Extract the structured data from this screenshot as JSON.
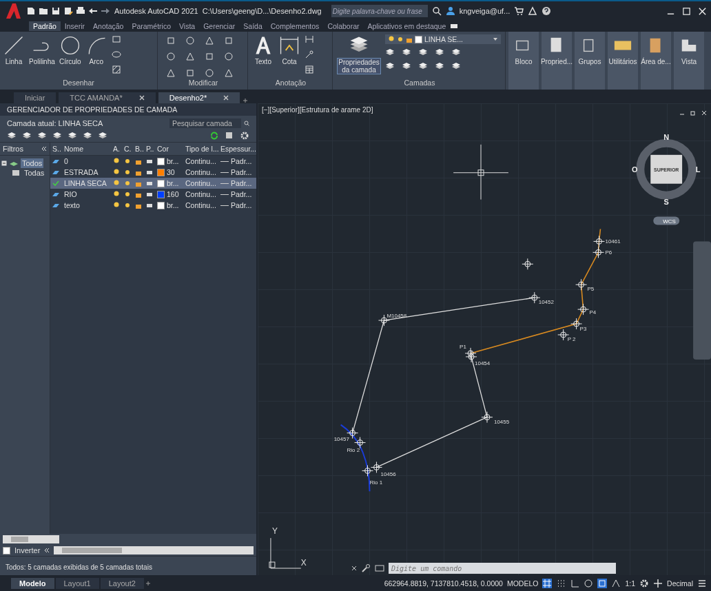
{
  "title_bar": {
    "title": "Autodesk AutoCAD 2021",
    "path": "C:\\Users\\geeng\\D...\\Desenho2.dwg",
    "search_placeholder": "Digite palavra-chave ou frase",
    "user": "kngveiga@uf..."
  },
  "ribbon_tabs": [
    {
      "label": "Padrão",
      "selected": true
    },
    {
      "label": "Inserir",
      "selected": false
    },
    {
      "label": "Anotação",
      "selected": false
    },
    {
      "label": "Paramétrico",
      "selected": false
    },
    {
      "label": "Vista",
      "selected": false
    },
    {
      "label": "Gerenciar",
      "selected": false
    },
    {
      "label": "Saída",
      "selected": false
    },
    {
      "label": "Complementos",
      "selected": false
    },
    {
      "label": "Colaborar",
      "selected": false
    },
    {
      "label": "Aplicativos em destaque",
      "selected": false
    }
  ],
  "draw_panel": {
    "title": "Desenhar",
    "tools": [
      "Linha",
      "Polilinha",
      "Círculo",
      "Arco"
    ]
  },
  "modify_panel": {
    "title": "Modificar"
  },
  "annotation_panel": {
    "title": "Anotação",
    "tools": [
      "Texto",
      "Cota"
    ]
  },
  "layers_panel": {
    "title": "Camadas",
    "button": "Propriedades da camada",
    "current_layer": "LINHA SE..."
  },
  "ribbon_buttons": [
    "Bloco",
    "Propried...",
    "Grupos",
    "Utilitários",
    "Área de...",
    "Vista"
  ],
  "doc_tabs": [
    {
      "label": "Iniciar",
      "selected": false,
      "closable": false
    },
    {
      "label": "TCC AMANDA*",
      "selected": false,
      "closable": true
    },
    {
      "label": "Desenho2*",
      "selected": true,
      "closable": true
    }
  ],
  "layer_manager": {
    "title": "GERENCIADOR DE PROPRIEDADES DE CAMADA",
    "current": "Camada atual: LINHA SECA",
    "search_placeholder": "Pesquisar camada",
    "filters_label": "Filtros",
    "filter_tree": [
      {
        "label": "Todos",
        "selected": true,
        "children": [
          {
            "label": "Todas",
            "selected": false
          }
        ]
      }
    ],
    "columns": [
      "S..",
      "Nome",
      "A.",
      "C.",
      "B..",
      "P..",
      "Cor",
      "Tipo de l...",
      "Espessur..."
    ],
    "layers": [
      {
        "name": "0",
        "current": false,
        "selected": false,
        "color": "#ffffff",
        "color_label": "br...",
        "linetype": "Continu...",
        "lineweight": "Padr..."
      },
      {
        "name": "ESTRADA",
        "current": false,
        "selected": false,
        "color": "#ff7f00",
        "color_label": "30",
        "linetype": "Continu...",
        "lineweight": "Padr..."
      },
      {
        "name": "LINHA SECA",
        "current": true,
        "selected": true,
        "color": "#ffffff",
        "color_label": "br...",
        "linetype": "Continu...",
        "lineweight": "Padr..."
      },
      {
        "name": "RIO",
        "current": false,
        "selected": false,
        "color": "#0040ff",
        "color_label": "160",
        "linetype": "Continu...",
        "lineweight": "Padr..."
      },
      {
        "name": "texto",
        "current": false,
        "selected": false,
        "color": "#ffffff",
        "color_label": "br...",
        "linetype": "Continu...",
        "lineweight": "Padr..."
      }
    ],
    "invert_label": "Inverter",
    "invert_checked": false,
    "status": "Todos: 5 camadas exibidas de 5 camadas totais"
  },
  "viewport": {
    "label": "[−][Superior][Estrutura de arame 2D]",
    "compass": {
      "north": "N",
      "south": "S",
      "west": "O",
      "east": "L",
      "center": "SUPERIOR"
    },
    "ucs": "WCS",
    "axis_x": "X",
    "axis_y": "Y",
    "point_labels": [
      "10461",
      "P6",
      "P5",
      "P4",
      "P3",
      "P 2",
      "P1",
      "10452",
      "M10458",
      "10454",
      "10455",
      "10457",
      "Rio 2",
      "Rio 1",
      "10456"
    ],
    "command_placeholder": "Digite um comando"
  },
  "layout_tabs": [
    {
      "label": "Modelo",
      "selected": true
    },
    {
      "label": "Layout1",
      "selected": false
    },
    {
      "label": "Layout2",
      "selected": false
    }
  ],
  "status_bar": {
    "coords": "662964.8819, 7137810.4518, 0.0000",
    "mode": "MODELO",
    "scale": "1:1",
    "units": "Decimal"
  }
}
